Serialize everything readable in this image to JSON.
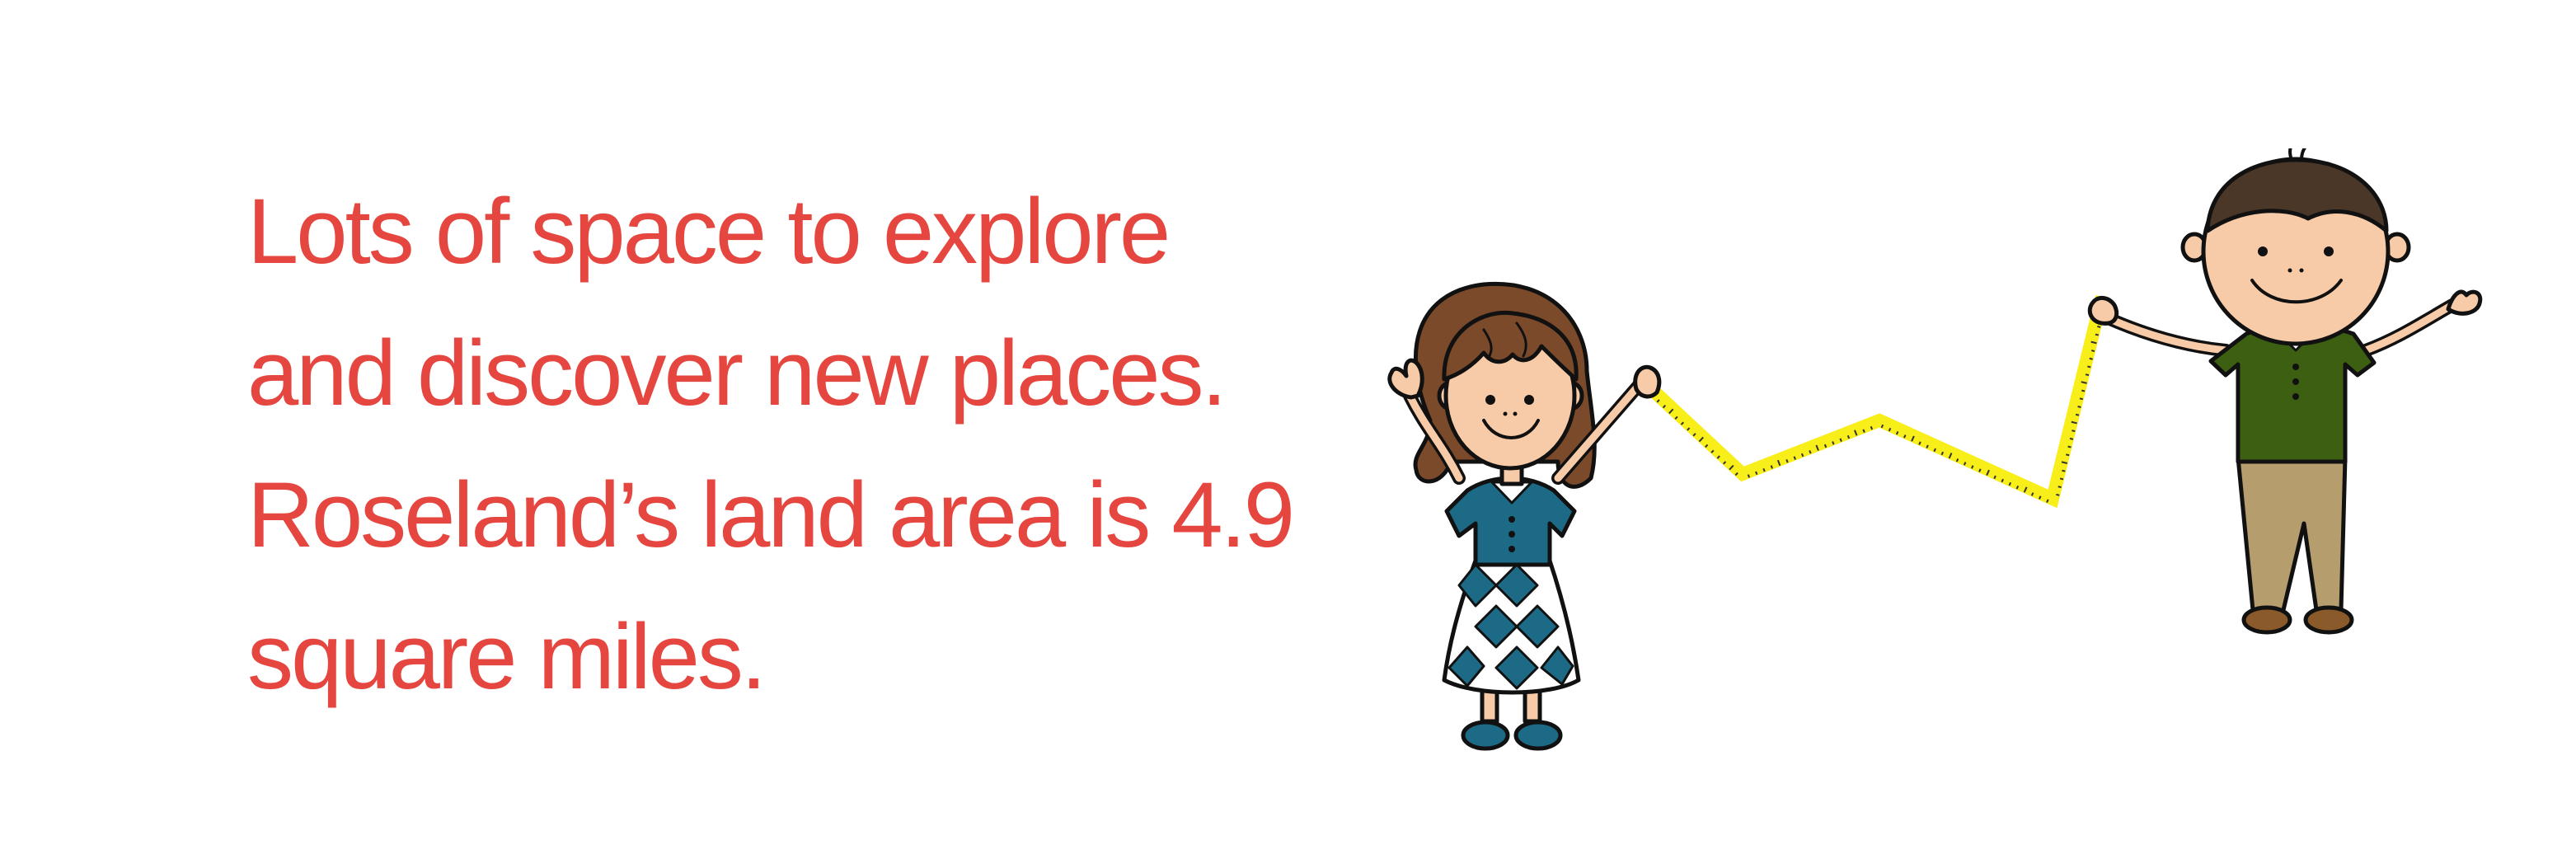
{
  "headline": {
    "lines": [
      "Lots of space to explore",
      "and discover new places.",
      "Roseland’s land area is 4.9",
      "square miles."
    ],
    "color": "#e5463f"
  },
  "illustration": {
    "figures": [
      "girl",
      "boy"
    ],
    "prop": "yellow-measuring-tape",
    "colors": {
      "tape": "#f7ee1a",
      "girl_hair": "#7b4a2a",
      "girl_dress": "#1d6a86",
      "boy_hair": "#4a3728",
      "boy_shirt": "#3d5f12",
      "boy_pants": "#b59d6e",
      "skin": "#f7cba8"
    }
  }
}
